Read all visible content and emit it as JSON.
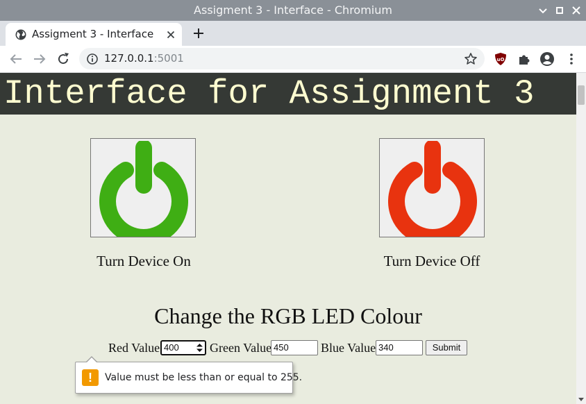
{
  "window": {
    "title": "Assigment 3 - Interface - Chromium"
  },
  "tabs": [
    {
      "title": "Assigment 3 - Interface",
      "favicon": "globe-icon"
    }
  ],
  "toolbar": {
    "url_host": "127.0.0.1",
    "url_port": ":5001"
  },
  "page": {
    "header": "Interface for Assignment 3",
    "buttons": {
      "on_label": "Turn Device On",
      "off_label": "Turn Device Off"
    },
    "rgb_form": {
      "heading": "Change the RGB LED Colour",
      "red_label": "Red Value",
      "red_value": "400",
      "green_label": "Green Value",
      "green_value": "450",
      "blue_label": "Blue Value",
      "blue_value": "340",
      "submit_label": "Submit"
    },
    "validation_message": "Value must be less than or equal to 255."
  },
  "colors": {
    "header_bg": "#353935",
    "header_text": "#fffdd0",
    "page_bg": "#e9ecdf",
    "power_on": "#3fae14",
    "power_off": "#e8330f",
    "warning": "#f29900"
  }
}
